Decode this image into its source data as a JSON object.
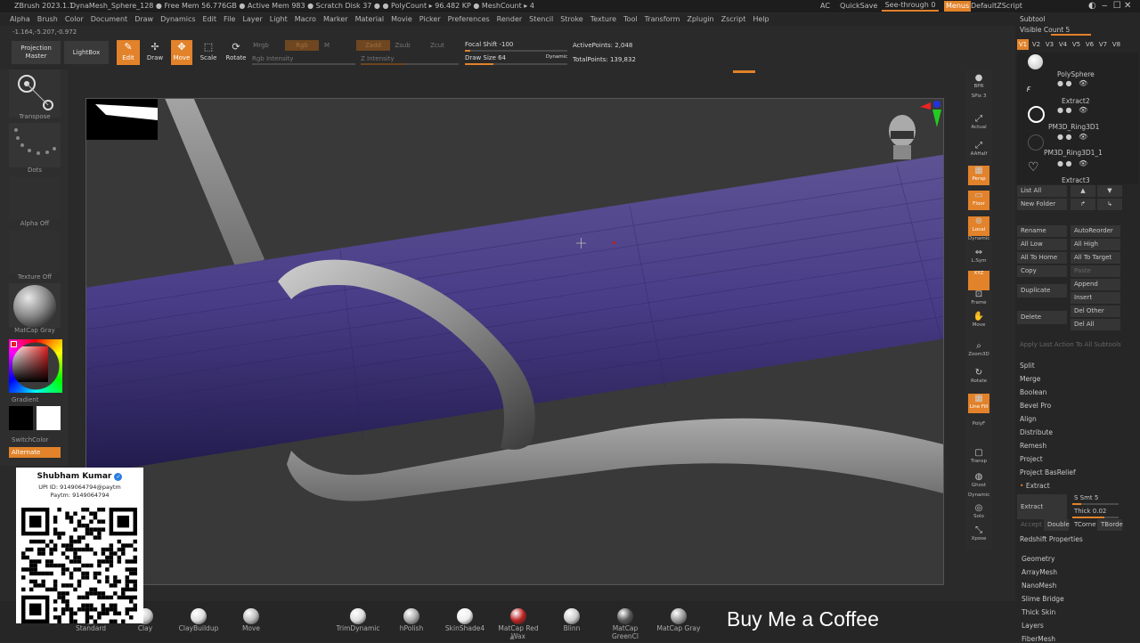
{
  "titlebar": {
    "app": "ZBrush 2023.1.1",
    "status": "DynaMesh_Sphere_128  ● Free Mem 56.776GB ● Active Mem 983 ● Scratch Disk 37 ● ● PolyCount ▸ 96.482 KP ● MeshCount ▸ 4",
    "ac": "AC",
    "quicksave": "QuickSave",
    "see_through": "See-through  0",
    "menus": "Menus",
    "script": "DefaultZScript"
  },
  "menu": [
    "Alpha",
    "Brush",
    "Color",
    "Document",
    "Draw",
    "Dynamics",
    "Edit",
    "File",
    "Layer",
    "Light",
    "Macro",
    "Marker",
    "Material",
    "Movie",
    "Picker",
    "Preferences",
    "Render",
    "Stencil",
    "Stroke",
    "Texture",
    "Tool",
    "Transform",
    "Zplugin",
    "Zscript",
    "Help"
  ],
  "coords": "-1.164,-5.207,-0.972",
  "toolbar": {
    "projection_master": "Projection Master",
    "lightbox": "LightBox",
    "edit": "Edit",
    "draw": "Draw",
    "move": "Move",
    "scale": "Scale",
    "rotate": "Rotate",
    "mrgb": "Mrgb",
    "rgb": "Rgb",
    "m": "M",
    "zadd": "Zadd",
    "zsub": "Zsub",
    "zcut": "Zcut",
    "rgb_intensity": "Rgb Intensity",
    "z_intensity": "Z Intensity",
    "focal_shift": "Focal Shift -100",
    "draw_size": "Draw Size 64",
    "dynamic": "Dynamic",
    "active_points": "ActivePoints: 2,048",
    "total_points": "TotalPoints: 139,832"
  },
  "left": {
    "transpose": "Transpose",
    "dots": "Dots",
    "alpha": "Alpha Off",
    "texture": "Texture Off",
    "material": "MatCap Gray",
    "gradient": "Gradient",
    "switch": "SwitchColor",
    "alternate": "Alternate"
  },
  "card": {
    "name": "Shubham Kumar",
    "upi": "UPI ID: 9149064794@paytm",
    "paytm": "Paytm: 9149064794"
  },
  "right_shelf": [
    "BPR",
    "SPix 3",
    "Actual",
    "AAHalf",
    "Persp",
    "Floor",
    "Local",
    "Dynamic",
    "L.Sym",
    "XYZ",
    "Frame",
    "Move",
    "Zoom3D",
    "Rotate",
    "Line Fill",
    "PolyF",
    "Transp",
    "Ghost",
    "Dynamic",
    "Solo",
    "Xpose"
  ],
  "subtool": {
    "title": "Subtool",
    "visible_count": "Visible Count 5",
    "versions": [
      "V1",
      "V2",
      "V3",
      "V4",
      "V5",
      "V6",
      "V7",
      "V8"
    ],
    "items": [
      "PolySphere",
      "Extract2",
      "PM3D_Ring3D1",
      "PM3D_Ring3D1_1",
      "Extract3"
    ],
    "list_all": "List All",
    "new_folder": "New Folder",
    "rename": "Rename",
    "autoreorder": "AutoReorder",
    "all_low": "All Low",
    "all_high": "All High",
    "all_to_home": "All To Home",
    "all_to_target": "All To Target",
    "copy": "Copy",
    "paste": "Paste",
    "append": "Append",
    "duplicate": "Duplicate",
    "insert": "Insert",
    "del_other": "Del Other",
    "delete": "Delete",
    "del_all": "Del All",
    "apply_last": "Apply Last Action To All Subtools",
    "split": "Split",
    "merge": "Merge",
    "boolean": "Boolean",
    "bevel_pro": "Bevel Pro",
    "align": "Align",
    "distribute": "Distribute",
    "remesh": "Remesh",
    "project": "Project",
    "project_basrelief": "Project BasRelief",
    "extract_header": "Extract",
    "extract": "Extract",
    "s_smt": "S Smt 5",
    "thick": "Thick 0.02",
    "accept": "Accept",
    "double": "Double",
    "tcorne": "TCorne",
    "tborde": "TBorde",
    "redshift": "Redshift Properties",
    "groups": [
      "Geometry",
      "ArrayMesh",
      "NanoMesh",
      "Slime Bridge",
      "Thick Skin",
      "Layers",
      "FiberMesh"
    ]
  },
  "brushes": [
    "Standard",
    "Clay",
    "ClayBuildup",
    "Move",
    "TrimDynamic",
    "hPolish",
    "SkinShade4",
    "MatCap Red Wax",
    "Blinn",
    "MatCap GreenCl",
    "MatCap Gray"
  ],
  "overlay": "Buy Me a Coffee"
}
